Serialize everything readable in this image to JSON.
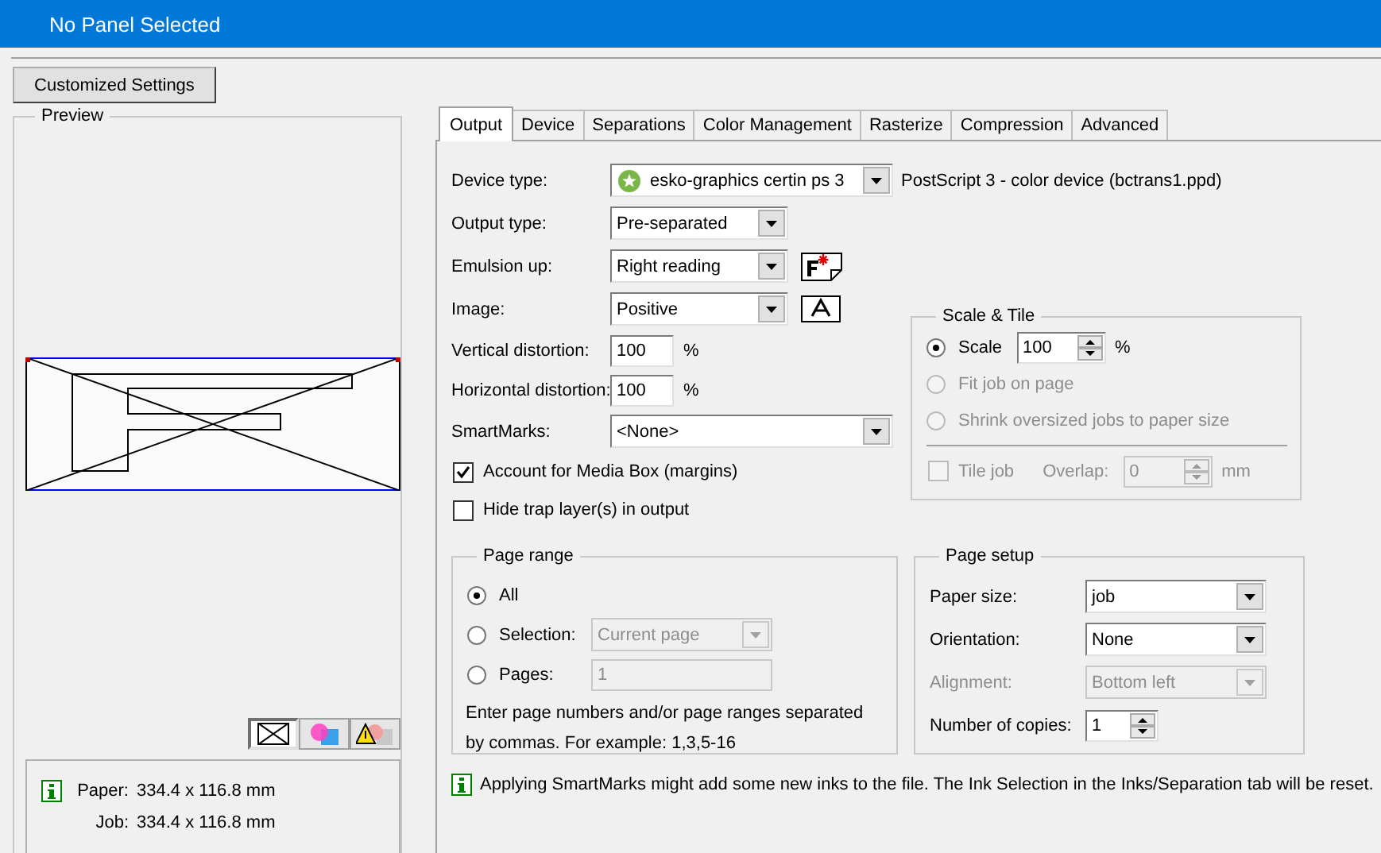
{
  "window": {
    "title": "No Panel Selected"
  },
  "customized_button": {
    "label": "Customized Settings"
  },
  "preview": {
    "title": "Preview",
    "view_buttons": [
      {
        "kind": "wireframe",
        "selected": true
      },
      {
        "kind": "color",
        "selected": false
      },
      {
        "kind": "warning",
        "selected": false
      }
    ],
    "info": [
      {
        "label": "Paper:",
        "value": "334.4 x 116.8 mm"
      },
      {
        "label": "Job:",
        "value": "334.4 x 116.8 mm"
      }
    ]
  },
  "tabs": [
    {
      "label": "Output",
      "selected": true
    },
    {
      "label": "Device",
      "selected": false
    },
    {
      "label": "Separations",
      "selected": false
    },
    {
      "label": "Color Management",
      "selected": false
    },
    {
      "label": "Rasterize",
      "selected": false
    },
    {
      "label": "Compression",
      "selected": false
    },
    {
      "label": "Advanced",
      "selected": false
    }
  ],
  "output": {
    "device_type": {
      "label": "Device type:",
      "value": "esko-graphics certin ps 3",
      "note": "PostScript 3 - color device (bctrans1.ppd)"
    },
    "output_type": {
      "label": "Output type:",
      "value": "Pre-separated"
    },
    "emulsion_up": {
      "label": "Emulsion up:",
      "value": "Right reading"
    },
    "image": {
      "label": "Image:",
      "value": "Positive"
    },
    "vertical_distortion": {
      "label": "Vertical distortion:",
      "value": "100",
      "unit": "%"
    },
    "horizontal_distortion": {
      "label": "Horizontal distortion:",
      "value": "100",
      "unit": "%"
    },
    "smartmarks": {
      "label": "SmartMarks:",
      "value": "<None>"
    },
    "checkboxes": [
      {
        "label": "Account for Media Box (margins)",
        "checked": true
      },
      {
        "label": "Hide trap layer(s) in output",
        "checked": false
      }
    ]
  },
  "scale_tile": {
    "title": "Scale & Tile",
    "options": [
      {
        "label": "Scale",
        "selected": true,
        "disabled": false,
        "value": "100",
        "unit": "%"
      },
      {
        "label": "Fit job on page",
        "selected": false,
        "disabled": true
      },
      {
        "label": "Shrink oversized jobs to paper size",
        "selected": false,
        "disabled": true
      }
    ],
    "tile_job": {
      "label": "Tile job",
      "checked": false,
      "disabled": true
    },
    "overlap": {
      "label": "Overlap:",
      "value": "0",
      "unit": "mm",
      "disabled": true
    }
  },
  "page_range": {
    "title": "Page range",
    "options": [
      {
        "kind": "plain",
        "label": "All",
        "selected": true
      },
      {
        "kind": "dropdown",
        "label": "Selection:",
        "selected": false,
        "value": "Current page",
        "disabled": true
      },
      {
        "kind": "field",
        "label": "Pages:",
        "selected": false,
        "value": "1",
        "disabled": true
      }
    ],
    "hint": "Enter page numbers and/or page ranges separated by commas. For example: 1,3,5-16"
  },
  "page_setup": {
    "title": "Page setup",
    "fields": [
      {
        "kind": "dropdown",
        "label": "Paper size:",
        "value": "job",
        "disabled": false
      },
      {
        "kind": "dropdown",
        "label": "Orientation:",
        "value": "None",
        "disabled": false
      },
      {
        "kind": "dropdown",
        "label": "Alignment:",
        "value": "Bottom left",
        "disabled": true
      },
      {
        "kind": "spinner",
        "label": "Number of copies:",
        "value": "1",
        "disabled": false
      }
    ]
  },
  "notice": {
    "text": "Applying SmartMarks might add some new inks to the file. The Ink Selection in the Inks/Separation tab will be reset."
  }
}
